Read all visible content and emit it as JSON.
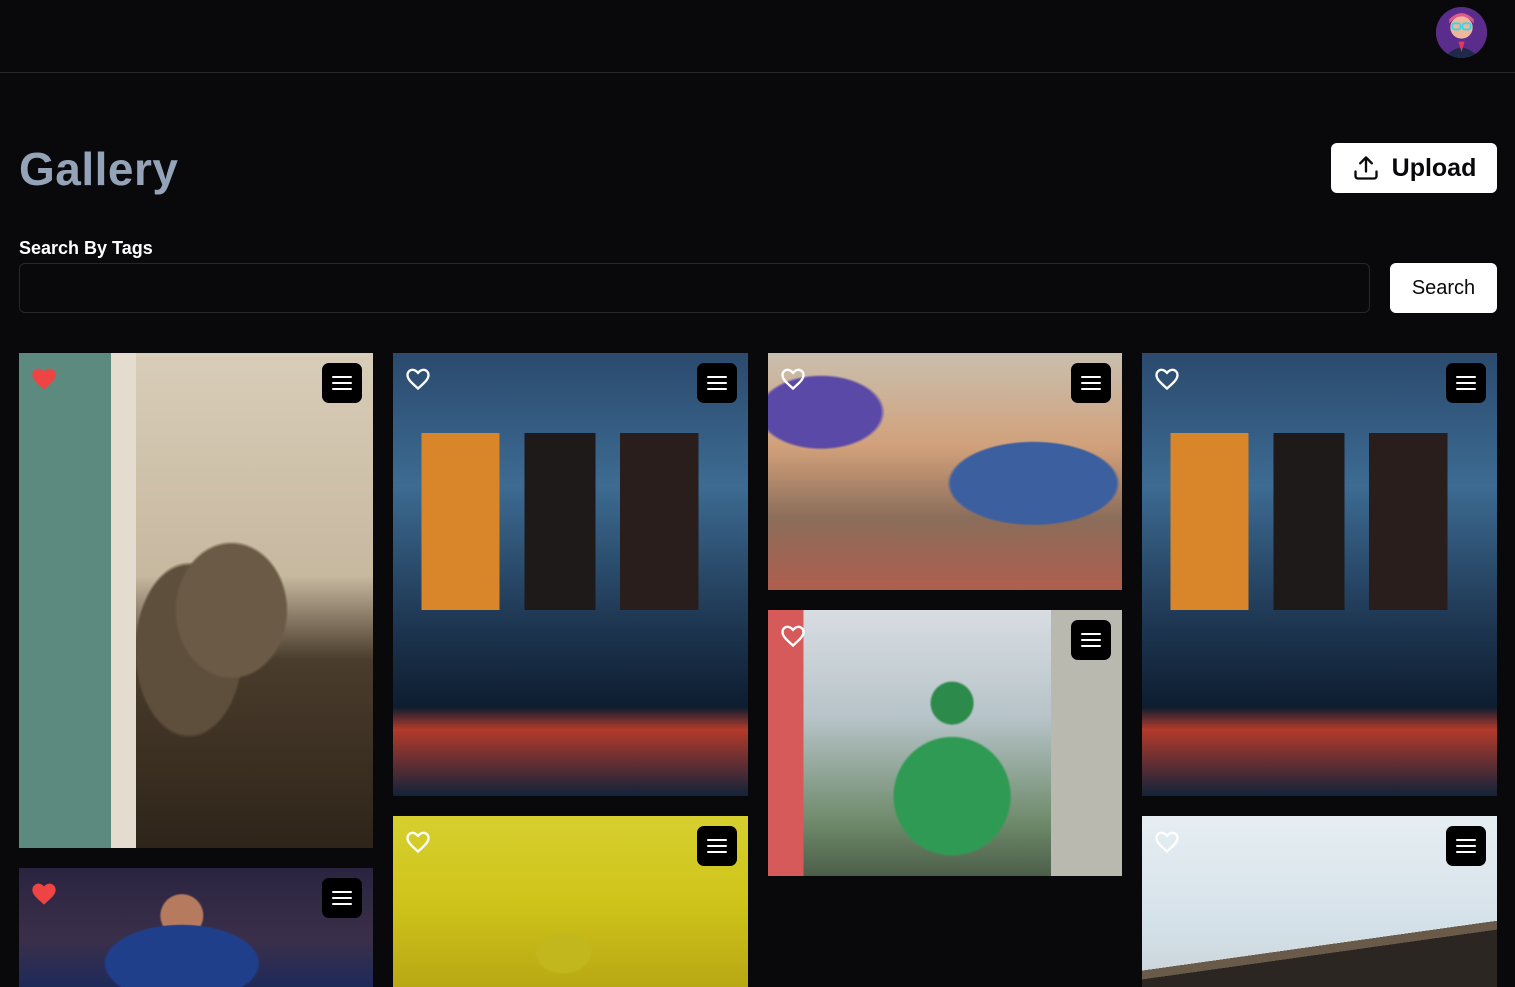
{
  "header": {
    "avatar_icon": "user-avatar"
  },
  "page": {
    "title": "Gallery",
    "upload_label": "Upload",
    "search_label": "Search By Tags",
    "search_value": "",
    "search_placeholder": "",
    "search_button": "Search"
  },
  "colors": {
    "background": "#09090b",
    "title": "#94a3b8",
    "favorite_active": "#ef4444",
    "favorite_inactive": "#ffffff",
    "button_bg": "#ffffff"
  },
  "gallery": {
    "images": [
      {
        "photo": "logs-by-door",
        "favorited": true
      },
      {
        "photo": "cassette-tapes",
        "favorited": false
      },
      {
        "photo": "tuk-tuk-street",
        "favorited": false
      },
      {
        "photo": "cassette-tapes",
        "favorited": false
      },
      {
        "photo": "rider-with-phone",
        "favorited": false
      },
      {
        "photo": "soccer-player",
        "favorited": true
      },
      {
        "photo": "yellow-flower-field",
        "favorited": false
      },
      {
        "photo": "modern-building",
        "favorited": false
      }
    ]
  }
}
